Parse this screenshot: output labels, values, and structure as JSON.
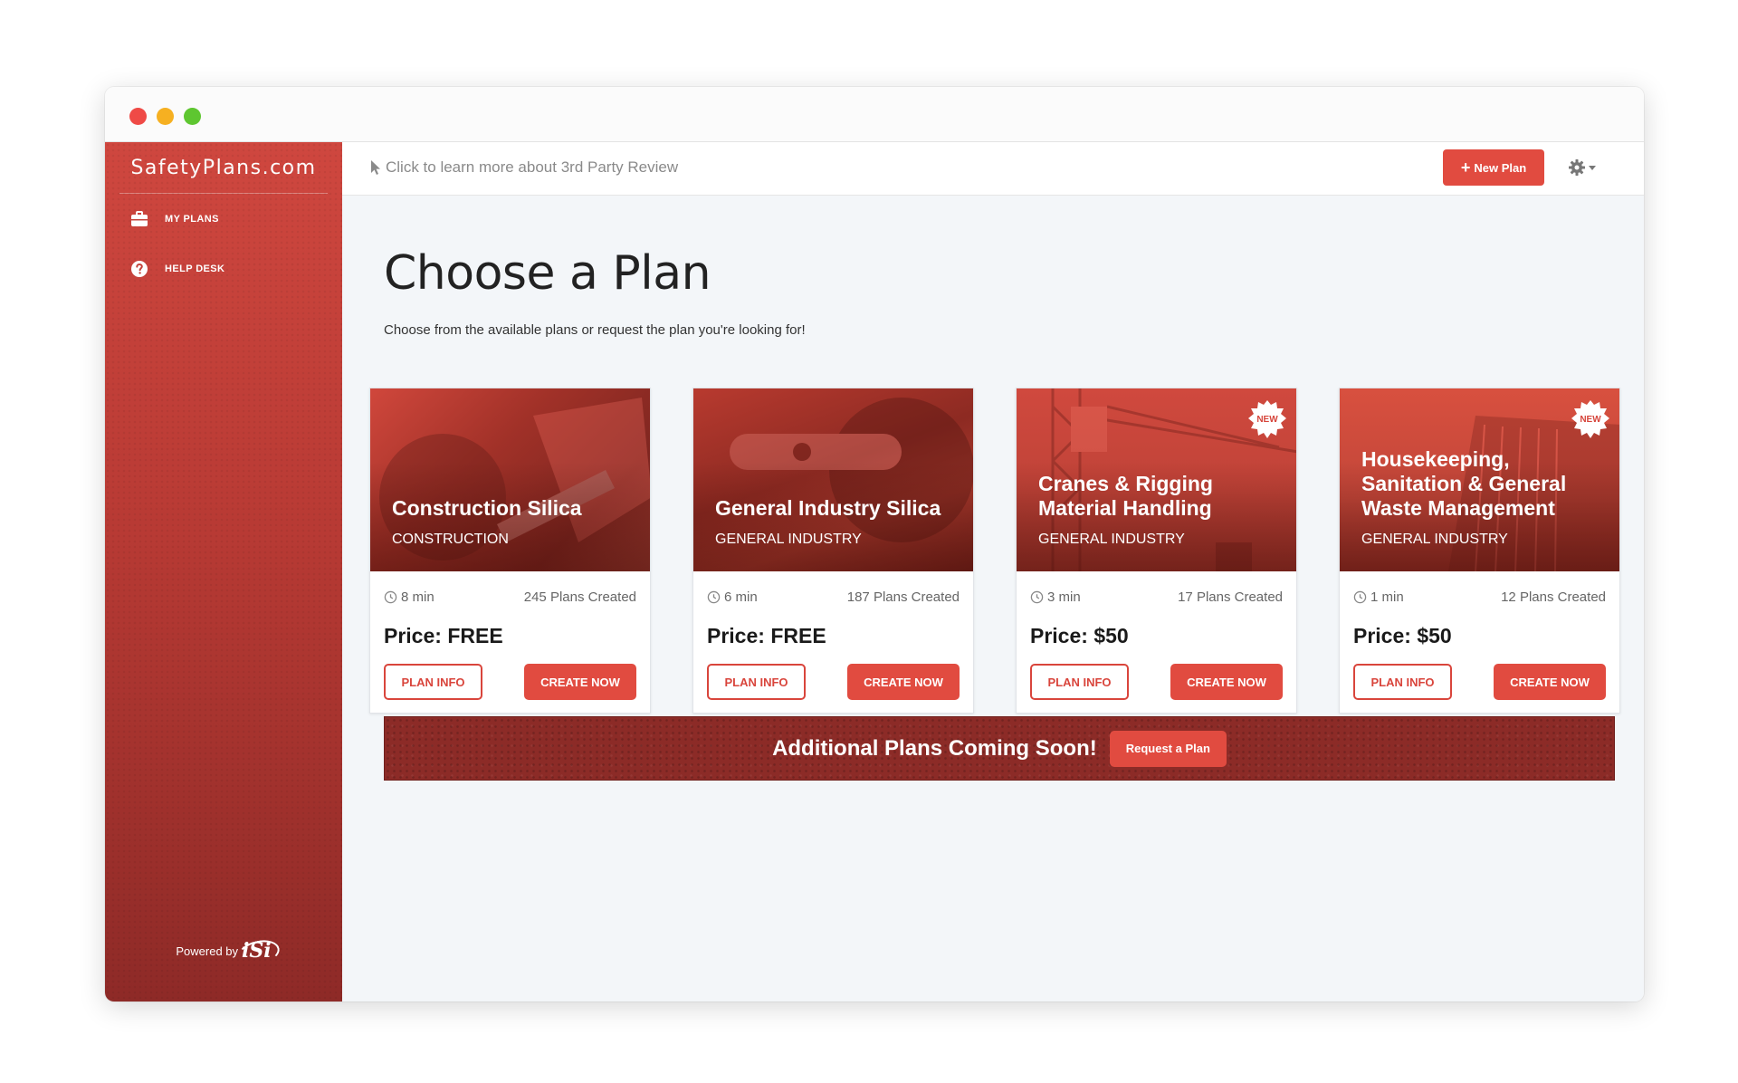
{
  "sidebar": {
    "brand": "SafetyPlans.com",
    "items": [
      {
        "label": "MY PLANS",
        "icon": "briefcase-icon"
      },
      {
        "label": "HELP DESK",
        "icon": "question-circle-icon"
      }
    ],
    "powered_by": "Powered by",
    "powered_logo": "iSi"
  },
  "topbar": {
    "review_link": "Click to learn more about 3rd Party Review",
    "new_plan_label": "New Plan"
  },
  "main": {
    "title": "Choose a Plan",
    "subtitle": "Choose from the available plans or request the plan you're looking for!"
  },
  "cards": [
    {
      "title": "Construction Silica",
      "category": "CONSTRUCTION",
      "time": "8 min",
      "plans_created": "245 Plans Created",
      "price": "Price: FREE",
      "is_new": false,
      "info_label": "PLAN INFO",
      "create_label": "CREATE NOW"
    },
    {
      "title": "General Industry Silica",
      "category": "GENERAL INDUSTRY",
      "time": "6 min",
      "plans_created": "187 Plans Created",
      "price": "Price: FREE",
      "is_new": false,
      "info_label": "PLAN INFO",
      "create_label": "CREATE NOW"
    },
    {
      "title": "Cranes & Rigging Material Handling",
      "category": "GENERAL INDUSTRY",
      "time": "3 min",
      "plans_created": "17 Plans Created",
      "price": "Price: $50",
      "is_new": true,
      "badge": "NEW",
      "info_label": "PLAN INFO",
      "create_label": "CREATE NOW"
    },
    {
      "title": "Housekeeping, Sanitation & General Waste Management",
      "category": "GENERAL INDUSTRY",
      "time": "1 min",
      "plans_created": "12 Plans Created",
      "price": "Price: $50",
      "is_new": true,
      "badge": "NEW",
      "info_label": "PLAN INFO",
      "create_label": "CREATE NOW"
    }
  ],
  "banner": {
    "text": "Additional Plans Coming Soon!",
    "button_label": "Request a Plan"
  },
  "colors": {
    "accent": "#e14b40",
    "sidebar_top": "#cf473f",
    "sidebar_bottom": "#8e2a27",
    "banner": "#8c2b27"
  }
}
